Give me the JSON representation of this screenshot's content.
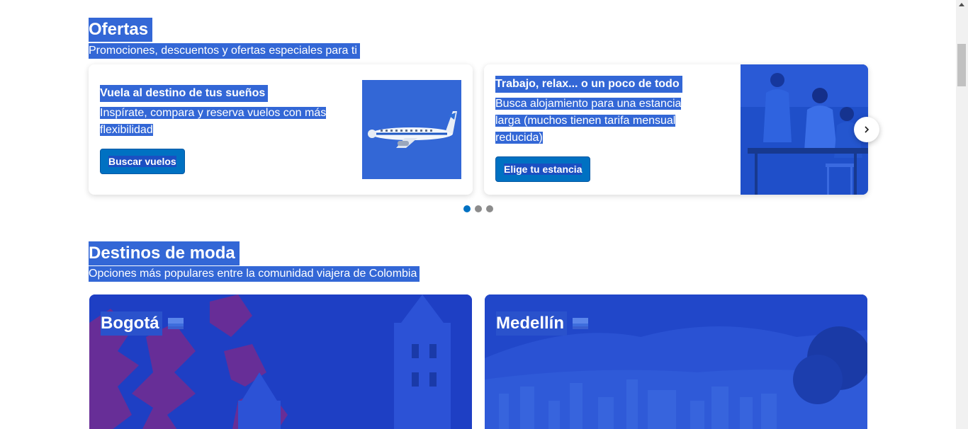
{
  "offers": {
    "title": "Ofertas",
    "subtitle": "Promociones, descuentos y ofertas especiales para ti",
    "cards": [
      {
        "title": "Vuela al destino de tus sueños",
        "text_line1": "Inspírate, compara y reserva vuelos con más",
        "text_line2": "flexibilidad",
        "cta": "Buscar vuelos",
        "image_icon": "airplane-icon"
      },
      {
        "title": "Trabajo, relax... o un poco de todo",
        "text_line1": "Busca alojamiento para una estancia",
        "text_line2": "larga (muchos tienen tarifa mensual",
        "text_line3": "reducida)",
        "cta": "Elige tu estancia",
        "image_icon": "people-working-photo"
      }
    ],
    "next_icon": "chevron-right-icon",
    "carousel_active_index": 0,
    "carousel_count": 3
  },
  "trending": {
    "title": "Destinos de moda",
    "subtitle": "Opciones más populares entre la comunidad viajera de Colombia",
    "destinations": [
      {
        "name": "Bogotá",
        "flag": "colombia-flag-icon"
      },
      {
        "name": "Medellín",
        "flag": "colombia-flag-icon"
      }
    ]
  },
  "colors": {
    "selection": "#3367d6",
    "cta": "#0071c2",
    "dot_active": "#0071c2",
    "dot_inactive": "#8c8c8c"
  }
}
